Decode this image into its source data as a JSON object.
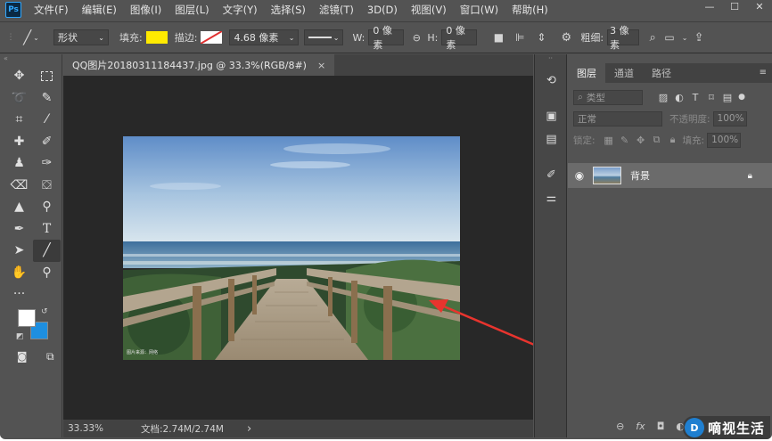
{
  "app": {
    "logo": "Ps"
  },
  "menu": [
    "文件(F)",
    "编辑(E)",
    "图像(I)",
    "图层(L)",
    "文字(Y)",
    "选择(S)",
    "滤镜(T)",
    "3D(D)",
    "视图(V)",
    "窗口(W)",
    "帮助(H)"
  ],
  "window_controls": [
    "—",
    "☐",
    "✕"
  ],
  "options": {
    "mode": "形状",
    "fill_label": "填充:",
    "fill_color": "#FFEA00",
    "stroke_label": "描边:",
    "stroke_width": "4.68 像素",
    "w_label": "W:",
    "w_value": "0 像素",
    "h_label": "H:",
    "h_value": "0 像素",
    "weight_label": "粗细:",
    "weight_value": "3 像素"
  },
  "document": {
    "tab_title": "QQ图片20180311184437.jpg @ 33.3%(RGB/8#)",
    "close": "×",
    "zoom": "33.33%",
    "doc_info": "文档:2.74M/2.74M",
    "scroll_arrow": "›",
    "photo_caption": "图片来源：网络"
  },
  "layers_panel": {
    "tabs": [
      "图层",
      "通道",
      "路径"
    ],
    "filter_kind": "类型",
    "blend_mode": "正常",
    "opacity_label": "不透明度:",
    "opacity_value": "100%",
    "lock_label": "锁定:",
    "fill_label": "填充:",
    "fill_value": "100%",
    "layer_name": "背景",
    "footer_icons": [
      "link-icon",
      "fx-icon",
      "mask-icon",
      "adjustment-icon"
    ],
    "footer_fx": "fx"
  },
  "watermark": {
    "logo": "D",
    "text": "嘀视生活"
  },
  "colors": {
    "accent_arrow": "#e8342e",
    "fill_swatch": "#FFEA00",
    "background_swatch": "#1e8fe0"
  }
}
